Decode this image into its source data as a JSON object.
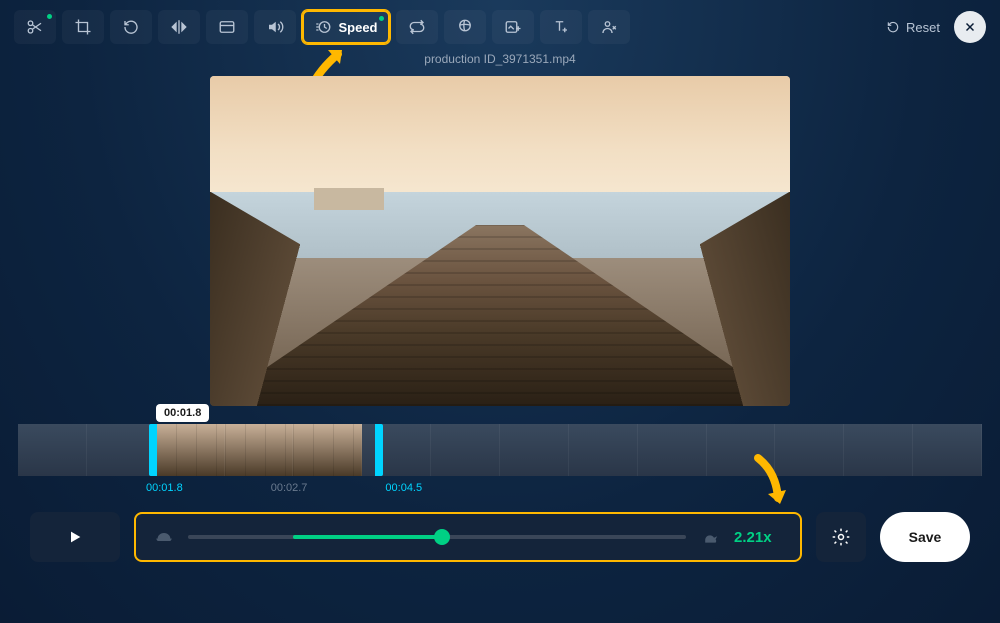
{
  "toolbar": {
    "speed_label": "Speed",
    "reset_label": "Reset"
  },
  "filename": "production ID_3971351.mp4",
  "timeline": {
    "tooltip": "00:01.8",
    "t1": "00:01.8",
    "t2": "00:02.7",
    "t3": "00:04.5"
  },
  "speed": {
    "value_label": "2.21x"
  },
  "save_label": "Save"
}
